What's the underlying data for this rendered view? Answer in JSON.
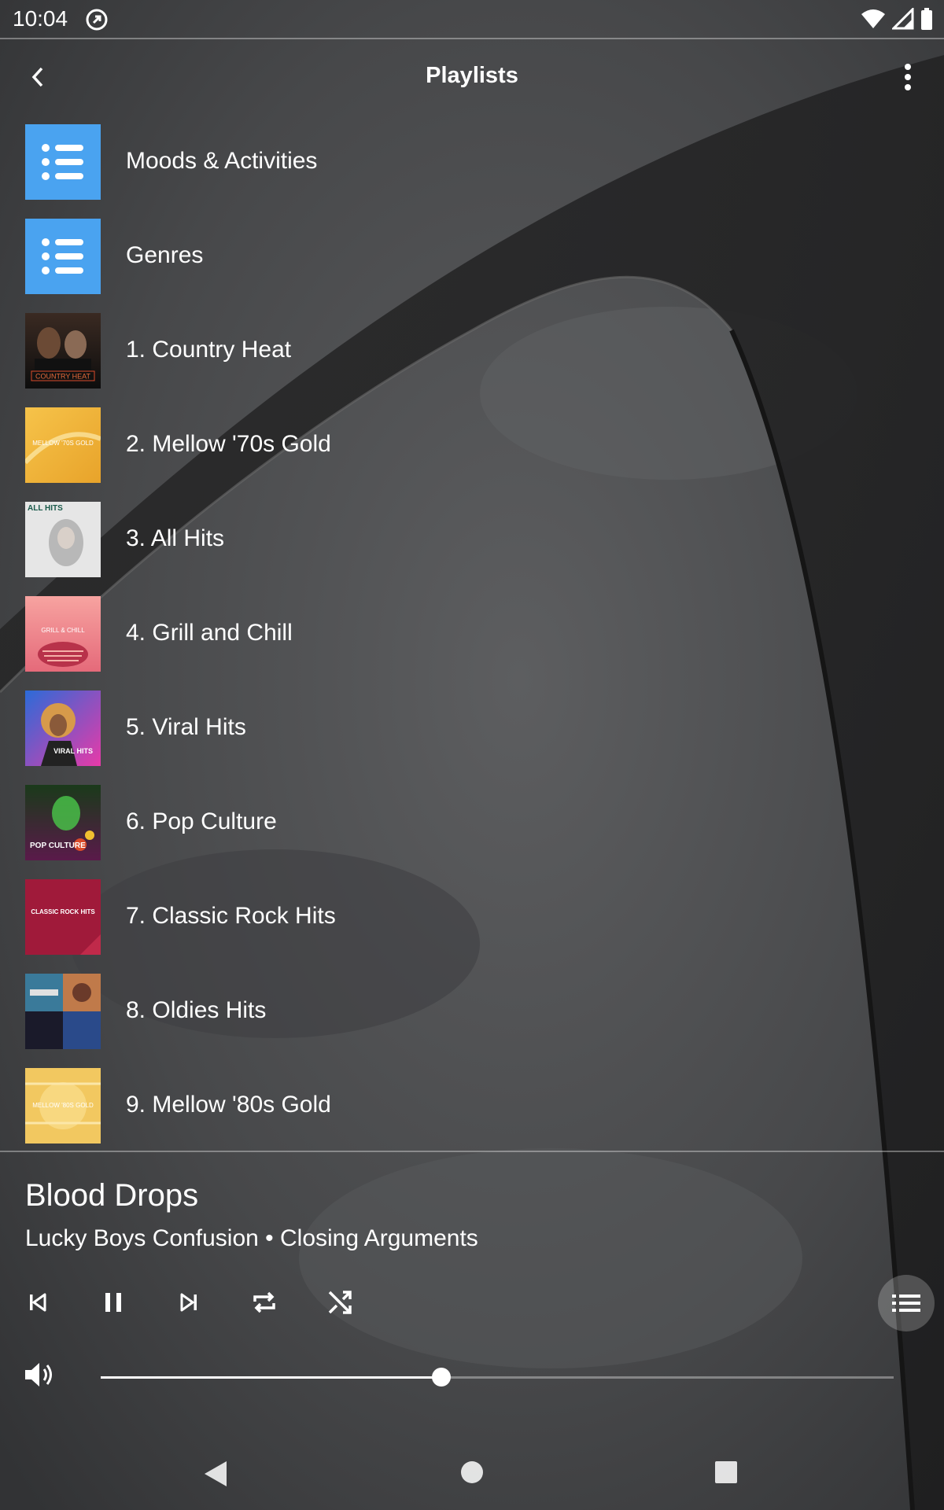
{
  "status_bar": {
    "time": "10:04"
  },
  "header": {
    "title": "Playlists"
  },
  "playlists": [
    {
      "label": "Moods & Activities",
      "art": "list-icon"
    },
    {
      "label": "Genres",
      "art": "list-icon"
    },
    {
      "label": "1. Country Heat",
      "art_text": "COUNTRY HEAT"
    },
    {
      "label": "2. Mellow '70s Gold",
      "art_text": "MELLOW '70S GOLD"
    },
    {
      "label": "3. All Hits",
      "art_text": "ALL HITS"
    },
    {
      "label": "4. Grill and Chill",
      "art_text": "GRILL & CHILL"
    },
    {
      "label": "5. Viral Hits",
      "art_text": "VIRAL HITS"
    },
    {
      "label": "6. Pop Culture",
      "art_text": "POP CULTURE"
    },
    {
      "label": "7. Classic Rock Hits",
      "art_text": "CLASSIC ROCK HITS"
    },
    {
      "label": "8. Oldies Hits",
      "art_text": ""
    },
    {
      "label": "9. Mellow '80s Gold",
      "art_text": "MELLOW '80S GOLD"
    }
  ],
  "now_playing": {
    "title": "Blood Drops",
    "subtitle": "Lucky Boys Confusion • Closing Arguments",
    "volume_fraction": 0.43
  },
  "icons": {
    "back": "chevron-left-icon",
    "overflow": "more-vert-icon",
    "previous": "skip-previous-icon",
    "pause": "pause-icon",
    "next": "skip-next-icon",
    "repeat": "repeat-icon",
    "shuffle": "shuffle-icon",
    "queue": "queue-list-icon",
    "volume": "volume-icon"
  },
  "colors": {
    "accent": "#4aa3f0",
    "text": "#ffffff"
  }
}
